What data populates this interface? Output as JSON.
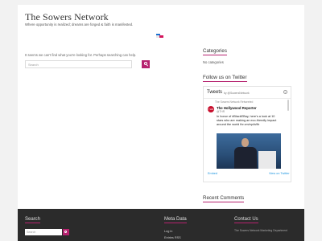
{
  "site": {
    "title": "The Sowers Network",
    "tagline": "Where opportunity is realized; dreams are forged & faith is manifested."
  },
  "main": {
    "not_found_text": "It seems we can't find what you're looking for. Perhaps searching can help.",
    "search_placeholder": "Search"
  },
  "sidebar": {
    "categories_title": "Categories",
    "categories_empty": "No categories",
    "twitter_title": "Follow us on Twitter",
    "recent_comments_title": "Recent Comments",
    "twitter_widget": {
      "heading": "Tweets",
      "by": "by @SowersNetwork",
      "retweet_note": "The Sowers Network Retweeted",
      "author_name": "The Hollywood Reporter",
      "author_handle": "@THR",
      "avatar_text": "THR",
      "tweet_text": "In honor of #BlackEBay, here's a look at 10 stars who are making an eco-friendly impact around the world thr.cm/ep4s9b",
      "embed_label": "Embed",
      "view_label": "View on Twitter"
    }
  },
  "footer": {
    "search_title": "Search",
    "search_placeholder": "Search",
    "meta_title": "Meta Data",
    "meta_links": [
      "Log in",
      "Entries RSS"
    ],
    "contact_title": "Contact Us",
    "contact_text": "The Sowers Network Marketing Department"
  },
  "colors": {
    "accent": "#b6226f",
    "footer_bg": "#2b2b2b",
    "link": "#1b95e0"
  }
}
